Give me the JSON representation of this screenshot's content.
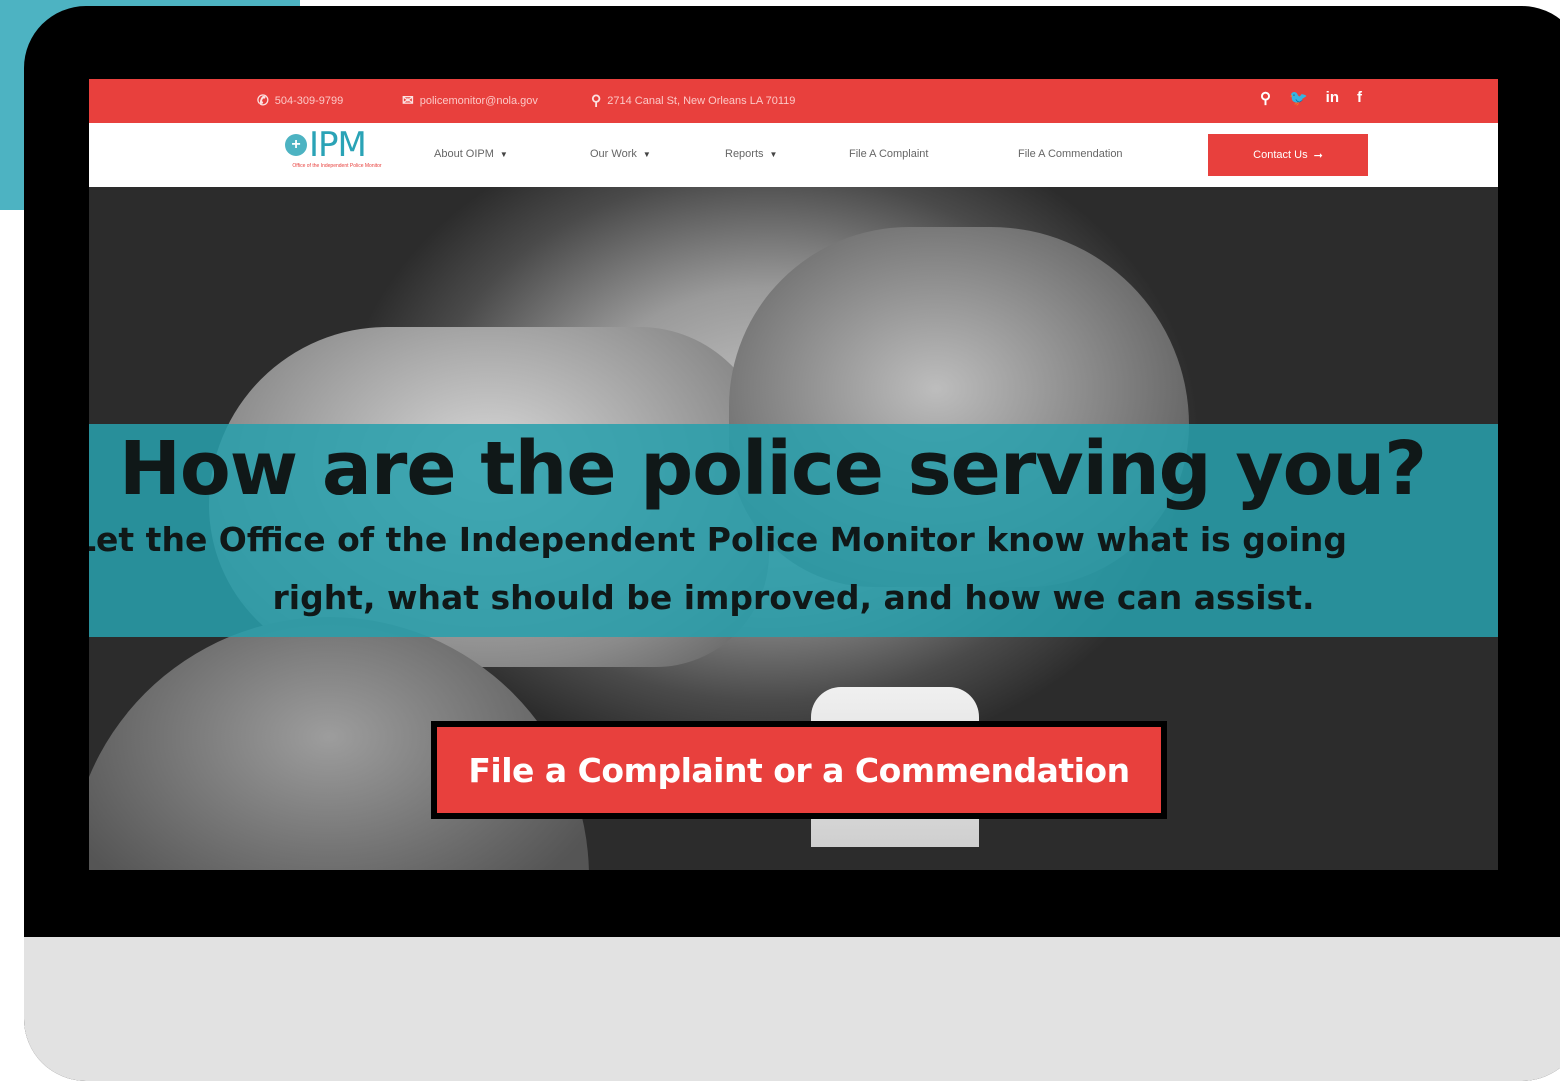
{
  "topbar": {
    "phone": "504-309-9799",
    "email": "policemonitor@nola.gov",
    "address": "2714 Canal St, New Orleans LA 70119",
    "social": [
      "Q",
      "🐦",
      "in",
      "f"
    ]
  },
  "logo": {
    "mark": "+",
    "text": "IPM",
    "tagline": "Office of the Independent Police Monitor"
  },
  "nav": {
    "items": [
      "About OIPM",
      "Our Work",
      "Reports",
      "File A Complaint",
      "File A Commendation"
    ],
    "contact_label": "Contact Us",
    "contact_arrow": "➞"
  },
  "hero": {
    "headline": "How are the police serving you?",
    "subline": "Let the Office of the Independent Police Monitor know what is going",
    "subline2": "right, what should be improved, and how we can assist.",
    "cta_label": "File a Complaint or a Commendation"
  },
  "colors": {
    "accent_red": "#e8403d",
    "accent_teal": "#4db3c2"
  }
}
